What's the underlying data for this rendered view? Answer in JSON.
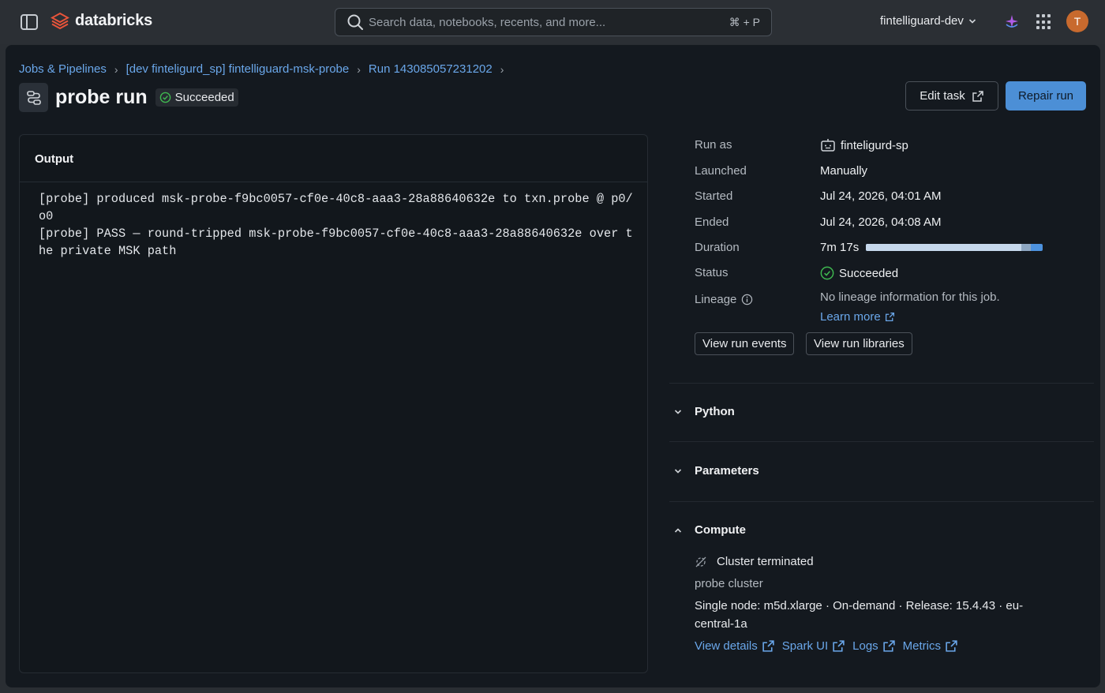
{
  "app": {
    "brand": "databricks",
    "workspace": "fintelliguard-dev",
    "avatar_initial": "T"
  },
  "search": {
    "placeholder": "Search data, notebooks, recents, and more...",
    "shortcut": "⌘ + P"
  },
  "breadcrumb": [
    "Jobs & Pipelines",
    "[dev finteligurd_sp] fintelliguard-msk-probe",
    "Run 143085057231202"
  ],
  "header": {
    "title": "probe run",
    "status": "Succeeded",
    "edit_task_label": "Edit task",
    "repair_run_label": "Repair run"
  },
  "output": {
    "title": "Output",
    "text": "[probe] produced msk-probe-f9bc0057-cf0e-40c8-aaa3-28a88640632e to txn.probe @ p0/o0\n[probe] PASS — round-tripped msk-probe-f9bc0057-cf0e-40c8-aaa3-28a88640632e over the private MSK path"
  },
  "details": {
    "run_as": {
      "label": "Run as",
      "value": "finteligurd-sp"
    },
    "launched": {
      "label": "Launched",
      "value": "Manually"
    },
    "started": {
      "label": "Started",
      "value": "Jul 24, 2026, 04:01 AM"
    },
    "ended": {
      "label": "Ended",
      "value": "Jul 24, 2026, 04:08 AM"
    },
    "duration": {
      "label": "Duration",
      "value": "7m 17s"
    },
    "status": {
      "label": "Status",
      "value": "Succeeded"
    },
    "lineage": {
      "label": "Lineage",
      "value": "No lineage information for this job.",
      "learn_more": "Learn more"
    },
    "view_run_events": "View run events",
    "view_run_libraries": "View run libraries"
  },
  "sections": {
    "python": "Python",
    "parameters": "Parameters",
    "compute": "Compute"
  },
  "compute": {
    "state": "Cluster terminated",
    "cluster_name": "probe cluster",
    "spec_line1": "Single node: m5d.xlarge · On-demand · Release: 15.4.43 · eu-",
    "spec_line2": "central-1a",
    "links": [
      "View details",
      "Spark UI",
      "Logs",
      "Metrics"
    ]
  },
  "colors": {
    "accent": "#4c8fd6",
    "link": "#6aa7ea",
    "success": "#3fb950",
    "background": "#14191f"
  },
  "icons": [
    "sidebar-toggle-icon",
    "databricks-logo-icon",
    "search-icon",
    "chevron-down-icon",
    "assistant-sparkle-icon",
    "app-grid-icon",
    "task-icon",
    "check-circle-icon",
    "external-link-icon",
    "robot-icon",
    "info-icon",
    "cluster-off-icon"
  ]
}
